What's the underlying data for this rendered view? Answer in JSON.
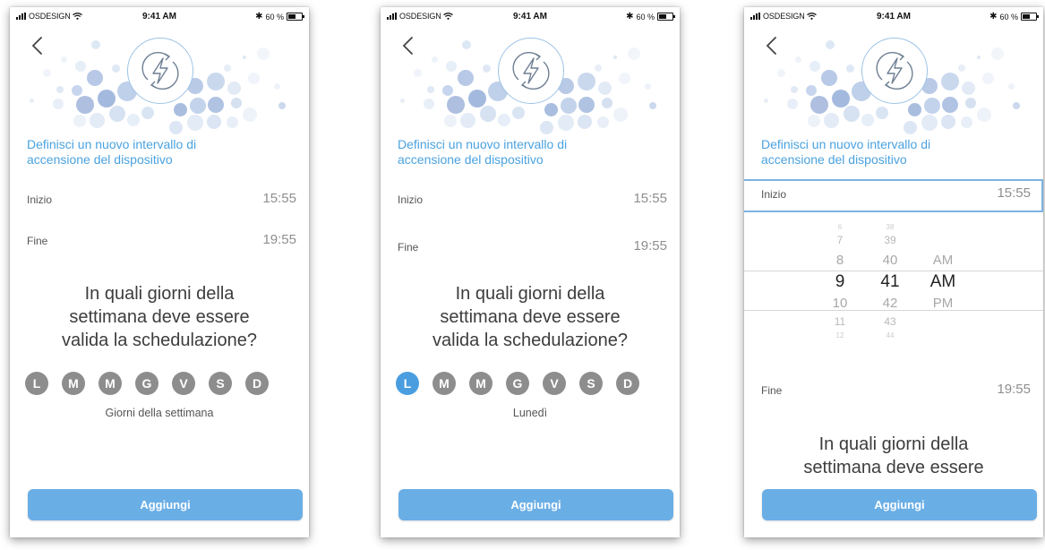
{
  "status_bar": {
    "carrier": "OSDESIGN",
    "time": "9:41 AM",
    "bluetooth": "✱",
    "battery_text": "60 %",
    "battery_level": 0.6
  },
  "headline": {
    "line1": "Definisci un nuovo intervallo di",
    "line2": "accensione del dispositivo"
  },
  "fields": {
    "start_label": "Inizio",
    "start_value": "15:55",
    "end_label": "Fine",
    "end_value": "19:55"
  },
  "question": {
    "line1": "In quali giorni della",
    "line2": "settimana deve essere",
    "line3": "valida la schedulazione?"
  },
  "days": [
    "L",
    "M",
    "M",
    "G",
    "V",
    "S",
    "D"
  ],
  "screens": [
    {
      "days_caption": "Giorni della settimana",
      "selected_day": ""
    },
    {
      "days_caption": "Lunedì",
      "selected_day": "L"
    }
  ],
  "picker": {
    "hours": [
      "6",
      "7",
      "8",
      "9",
      "10",
      "11",
      "12"
    ],
    "minutes": [
      "38",
      "39",
      "40",
      "41",
      "42",
      "43",
      "44"
    ],
    "periods": [
      "AM",
      "AM",
      "PM"
    ],
    "selected_hour": "9",
    "selected_minute": "41",
    "selected_period": "AM"
  },
  "add_button_label": "Aggiungi",
  "colors": {
    "accent": "#4aa2e0",
    "button": "#6aaee6",
    "day_inactive": "#8d8d8d",
    "day_selected": "#4a9ee0"
  },
  "icons": {
    "back": "chevron-left-icon",
    "power": "power-lightning-icon",
    "signal": "signal-bars-icon",
    "wifi": "wifi-icon",
    "bluetooth": "bluetooth-icon",
    "battery": "battery-icon"
  }
}
